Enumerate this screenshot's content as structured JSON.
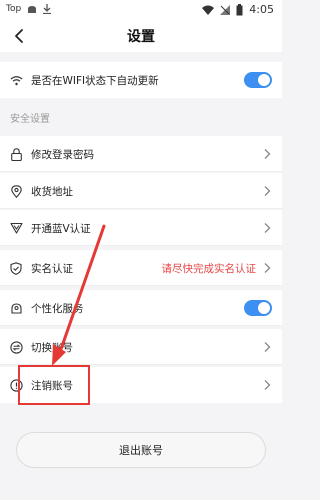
{
  "status_bar": {
    "carrier": "Top",
    "time": "4:05"
  },
  "nav": {
    "title": "设置"
  },
  "wifi_row": {
    "label": "是否在WIFI状态下自动更新",
    "toggle_on": true
  },
  "section": {
    "header": "安全设置"
  },
  "items": [
    {
      "label": "修改登录密码",
      "icon": "lock-icon"
    },
    {
      "label": "收货地址",
      "icon": "location-pin-icon"
    },
    {
      "label": "开通蓝V认证",
      "icon": "v-shield-icon"
    },
    {
      "label": "实名认证",
      "icon": "verify-shield-icon",
      "hint": "请尽快完成实名认证"
    },
    {
      "label": "个性化服务",
      "icon": "user-cloud-icon",
      "toggle_on": true
    },
    {
      "label": "切换账号",
      "icon": "switch-icon"
    },
    {
      "label": "注销账号",
      "icon": "info-circle-icon"
    }
  ],
  "logout": {
    "label": "退出账号"
  },
  "colors": {
    "accent": "#3d8ff2",
    "warning": "#e54848",
    "annotation": "#e53935"
  }
}
